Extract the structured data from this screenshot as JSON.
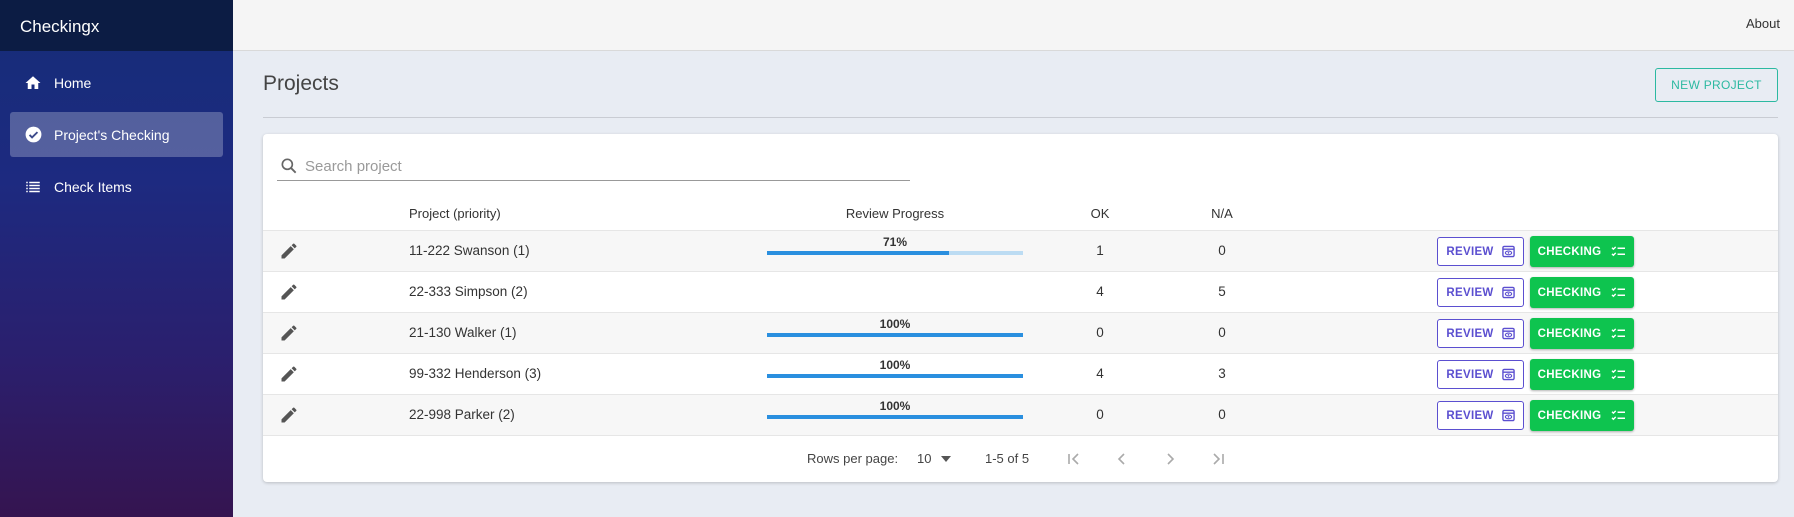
{
  "app": {
    "brand": "Checkingx"
  },
  "sidebar": {
    "items": [
      {
        "label": "Home",
        "icon": "home-icon"
      },
      {
        "label": "Project's Checking",
        "icon": "check-circle-icon",
        "active": true
      },
      {
        "label": "Check Items",
        "icon": "list-icon"
      }
    ]
  },
  "topbar": {
    "about": "About"
  },
  "header": {
    "title": "Projects",
    "new_project": "NEW PROJECT"
  },
  "search": {
    "placeholder": "Search project",
    "value": ""
  },
  "table": {
    "columns": {
      "project": "Project (priority)",
      "progress": "Review Progress",
      "ok": "OK",
      "na": "N/A"
    },
    "rows": [
      {
        "project": "11-222 Swanson (1)",
        "progress_label": "71%",
        "progress": 0.71,
        "ok": "1",
        "na": "0",
        "review": "REVIEW",
        "checking": "CHECKING"
      },
      {
        "project": "22-333 Simpson (2)",
        "progress_label": "",
        "progress": null,
        "ok": "4",
        "na": "5",
        "review": "REVIEW",
        "checking": "CHECKING"
      },
      {
        "project": "21-130 Walker (1)",
        "progress_label": "100%",
        "progress": 1.0,
        "ok": "0",
        "na": "0",
        "review": "REVIEW",
        "checking": "CHECKING"
      },
      {
        "project": "99-332 Henderson (3)",
        "progress_label": "100%",
        "progress": 1.0,
        "ok": "4",
        "na": "3",
        "review": "REVIEW",
        "checking": "CHECKING"
      },
      {
        "project": "22-998 Parker (2)",
        "progress_label": "100%",
        "progress": 1.0,
        "ok": "0",
        "na": "0",
        "review": "REVIEW",
        "checking": "CHECKING"
      }
    ]
  },
  "pagination": {
    "rows_per_page_label": "Rows per page:",
    "rows_per_page": "10",
    "range": "1-5 of 5"
  },
  "colors": {
    "accent_teal": "#2cb9a1",
    "review_purple": "#5b4fd0",
    "checking_green": "#0ec44f",
    "progress_blue": "#2a8fdf"
  }
}
